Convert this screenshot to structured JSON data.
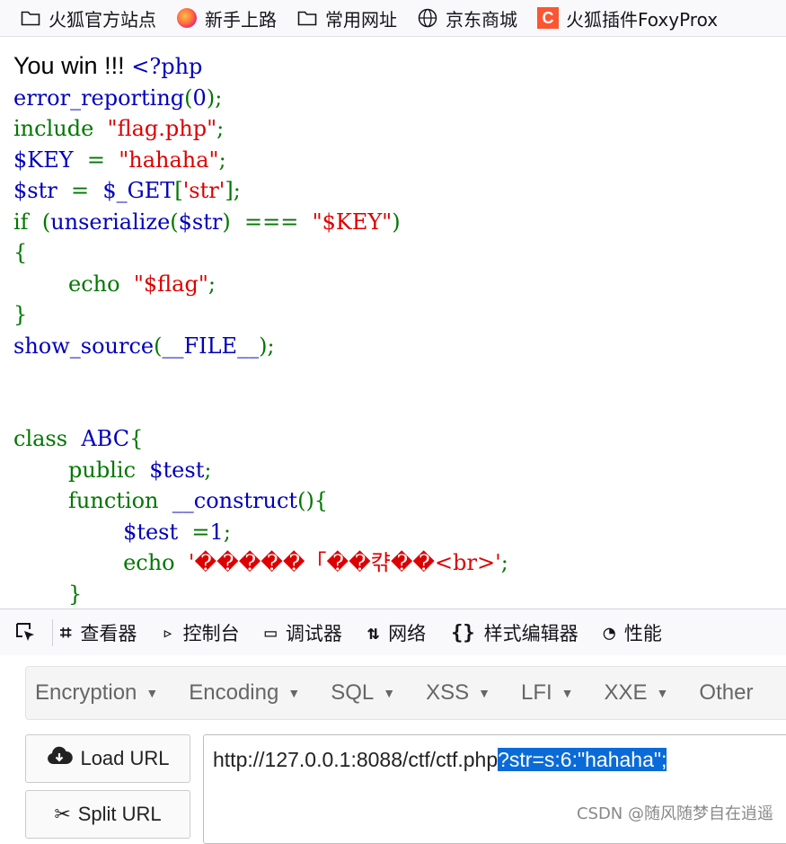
{
  "bookmarks": [
    {
      "label": "火狐官方站点",
      "icon": "folder-icon"
    },
    {
      "label": "新手上路",
      "icon": "firefox-icon"
    },
    {
      "label": "常用网址",
      "icon": "folder-icon"
    },
    {
      "label": "京东商城",
      "icon": "globe-icon"
    },
    {
      "label": "火狐插件FoxyProx",
      "icon": "csdn-c-icon"
    }
  ],
  "page": {
    "win_text": "You win !!!",
    "code_lines": [
      [
        {
          "t": " <?php",
          "c": "default"
        }
      ],
      [
        {
          "t": "error_reporting",
          "c": "default"
        },
        {
          "t": "(",
          "c": "keyword"
        },
        {
          "t": "0",
          "c": "default"
        },
        {
          "t": ");",
          "c": "keyword"
        }
      ],
      [
        {
          "t": "include ",
          "c": "keyword"
        },
        {
          "t": " \"flag.php\"",
          "c": "string"
        },
        {
          "t": ";",
          "c": "keyword"
        }
      ],
      [
        {
          "t": "$KEY ",
          "c": "default"
        },
        {
          "t": " = ",
          "c": "keyword"
        },
        {
          "t": " \"hahaha\"",
          "c": "string"
        },
        {
          "t": ";",
          "c": "keyword"
        }
      ],
      [
        {
          "t": "$str ",
          "c": "default"
        },
        {
          "t": " = ",
          "c": "keyword"
        },
        {
          "t": " $_GET",
          "c": "default"
        },
        {
          "t": "[",
          "c": "keyword"
        },
        {
          "t": "'str'",
          "c": "string"
        },
        {
          "t": "];",
          "c": "keyword"
        }
      ],
      [
        {
          "t": "if ",
          "c": "keyword"
        },
        {
          "t": " (",
          "c": "keyword"
        },
        {
          "t": "unserialize",
          "c": "default"
        },
        {
          "t": "(",
          "c": "keyword"
        },
        {
          "t": "$str",
          "c": "default"
        },
        {
          "t": ") ",
          "c": "keyword"
        },
        {
          "t": " === ",
          "c": "keyword"
        },
        {
          "t": " \"$KEY\"",
          "c": "string"
        },
        {
          "t": ")",
          "c": "keyword"
        }
      ],
      [
        {
          "t": "{",
          "c": "keyword"
        }
      ],
      [
        {
          "t": "        echo ",
          "c": "keyword"
        },
        {
          "t": " \"$flag\"",
          "c": "string"
        },
        {
          "t": ";",
          "c": "keyword"
        }
      ],
      [
        {
          "t": "}",
          "c": "keyword"
        }
      ],
      [
        {
          "t": "show_source",
          "c": "default"
        },
        {
          "t": "(",
          "c": "keyword"
        },
        {
          "t": "__FILE__",
          "c": "default"
        },
        {
          "t": ");",
          "c": "keyword"
        }
      ],
      [
        {
          "t": " ",
          "c": "default"
        }
      ],
      [
        {
          "t": " ",
          "c": "default"
        }
      ],
      [
        {
          "t": "class ",
          "c": "keyword"
        },
        {
          "t": " ABC",
          "c": "default"
        },
        {
          "t": "{",
          "c": "keyword"
        }
      ],
      [
        {
          "t": "        public ",
          "c": "keyword"
        },
        {
          "t": " $test",
          "c": "default"
        },
        {
          "t": ";",
          "c": "keyword"
        }
      ],
      [
        {
          "t": "        function ",
          "c": "keyword"
        },
        {
          "t": " __construct",
          "c": "default"
        },
        {
          "t": "(){",
          "c": "keyword"
        }
      ],
      [
        {
          "t": "                $test ",
          "c": "default"
        },
        {
          "t": " =",
          "c": "keyword"
        },
        {
          "t": "1",
          "c": "default"
        },
        {
          "t": ";",
          "c": "keyword"
        }
      ],
      [
        {
          "t": "                echo ",
          "c": "keyword"
        },
        {
          "t": " '�����「��캮��<br>'",
          "c": "string"
        },
        {
          "t": ";",
          "c": "keyword"
        }
      ],
      [
        {
          "t": "        }",
          "c": "keyword"
        }
      ]
    ]
  },
  "devtools": {
    "tabs": [
      {
        "label": "查看器",
        "icon": "inspector-icon",
        "glyph": "⌗"
      },
      {
        "label": "控制台",
        "icon": "console-icon",
        "glyph": "▹"
      },
      {
        "label": "调试器",
        "icon": "debugger-icon",
        "glyph": "▭"
      },
      {
        "label": "网络",
        "icon": "network-icon",
        "glyph": "⇅"
      },
      {
        "label": "样式编辑器",
        "icon": "style-editor-icon",
        "glyph": "{}"
      },
      {
        "label": "性能",
        "icon": "performance-icon",
        "glyph": "◔"
      }
    ]
  },
  "hackbar": {
    "menu": [
      "Encryption",
      "Encoding",
      "SQL",
      "XSS",
      "LFI",
      "XXE",
      "Other"
    ],
    "load_url": "Load URL",
    "split_url": "Split URL",
    "url_plain": "http://127.0.0.1:8088/ctf/ctf.php",
    "url_selected": "?str=s:6:\"hahaha\";"
  },
  "watermark": "CSDN @随风随梦自在逍遥",
  "colors": {
    "php_default": "#0000bb",
    "php_keyword": "#007700",
    "php_string": "#dd0000",
    "selection": "#0a6bd8"
  }
}
